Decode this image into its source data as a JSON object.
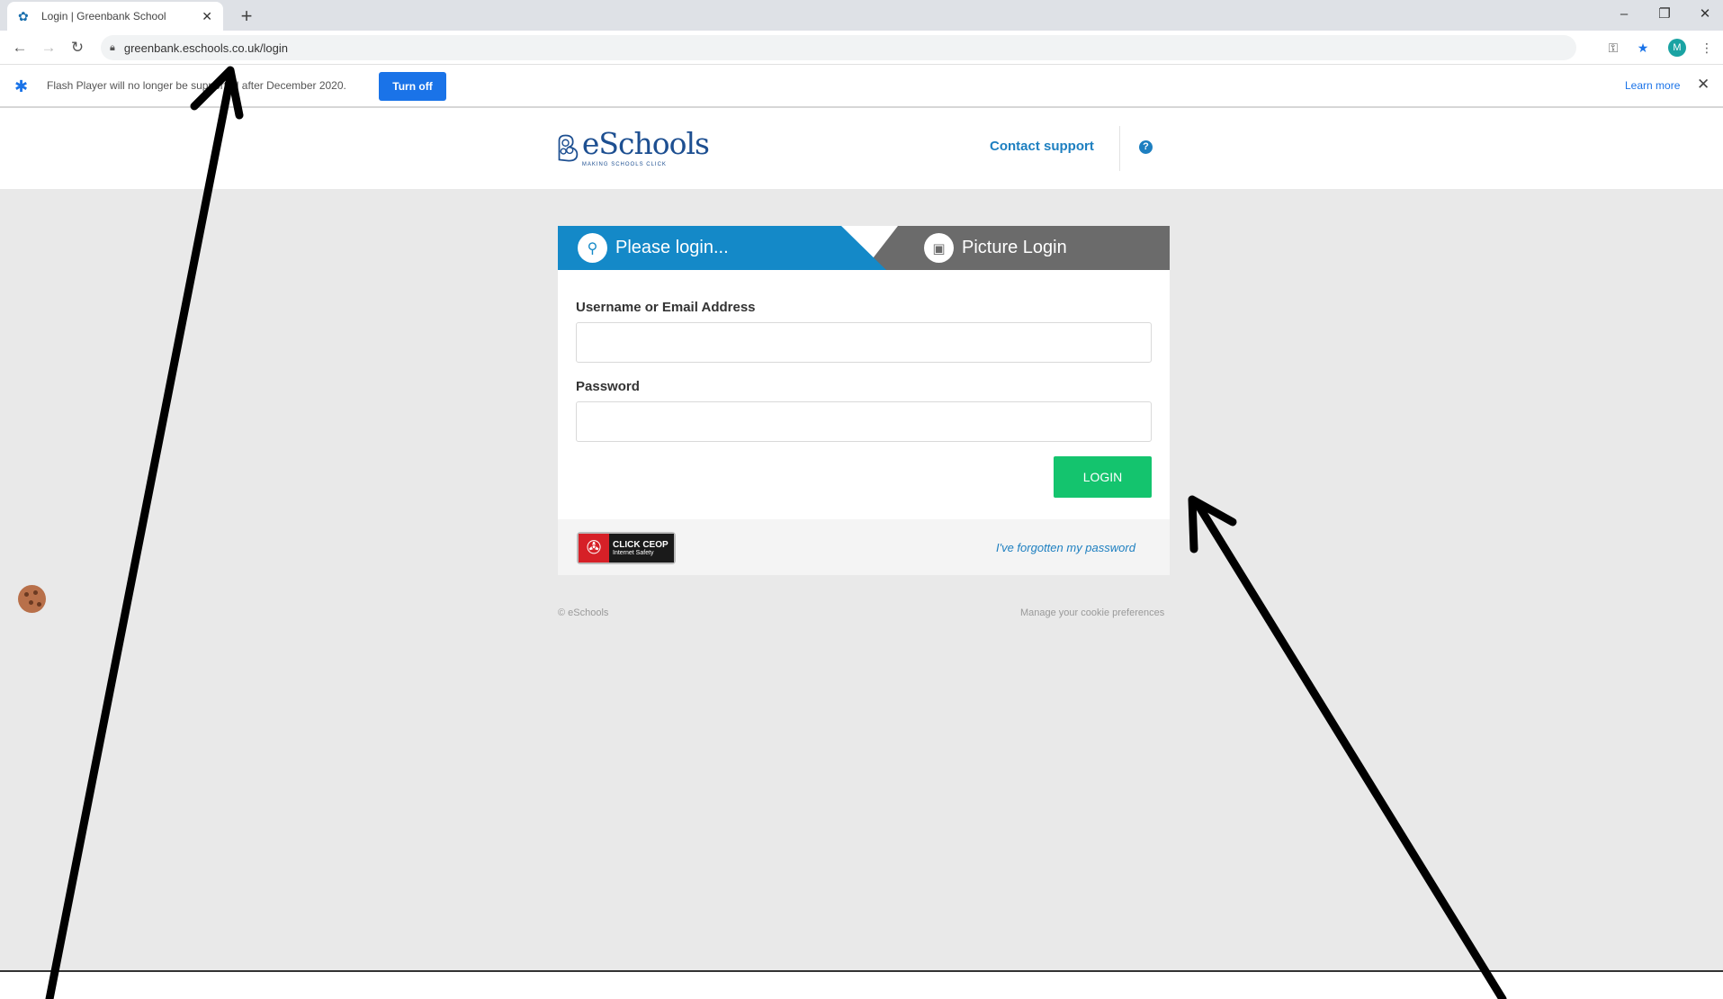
{
  "browser": {
    "tab_title": "Login | Greenbank School",
    "tab_favicon": "eschools-favicon",
    "new_tab": "+",
    "url": "greenbank.eschools.co.uk/login",
    "profile_initial": "M",
    "infobar": {
      "message": "Flash Player will no longer be supported after December 2020.",
      "button": "Turn off",
      "link": "Learn more"
    }
  },
  "header": {
    "logo_text": "eSchools",
    "logo_tagline": "MAKING SCHOOLS CLICK",
    "contact_support": "Contact support",
    "help": "?"
  },
  "login": {
    "tab_login": "Please login...",
    "tab_picture": "Picture Login",
    "username_label": "Username or Email Address",
    "username_value": "",
    "password_label": "Password",
    "password_value": "",
    "login_button": "LOGIN",
    "ceop_line1": "CLICK CEOP",
    "ceop_line2": "Internet Safety",
    "forgot_link": "I've forgotten my password"
  },
  "footer": {
    "copyright": "© eSchools",
    "cookie_preferences": "Manage your cookie preferences"
  },
  "colors": {
    "brand_blue": "#1489c8",
    "login_green": "#14c46e",
    "tab_grey": "#6b6b6b",
    "page_bg": "#e9e9e9"
  },
  "icons": [
    "eschools-favicon",
    "back-icon",
    "forward-icon",
    "reload-icon",
    "lock-icon",
    "key-icon",
    "star-icon",
    "menu-icon",
    "puzzle-icon",
    "close-icon",
    "help-icon",
    "search-key-icon",
    "picture-icon",
    "cookie-icon"
  ]
}
